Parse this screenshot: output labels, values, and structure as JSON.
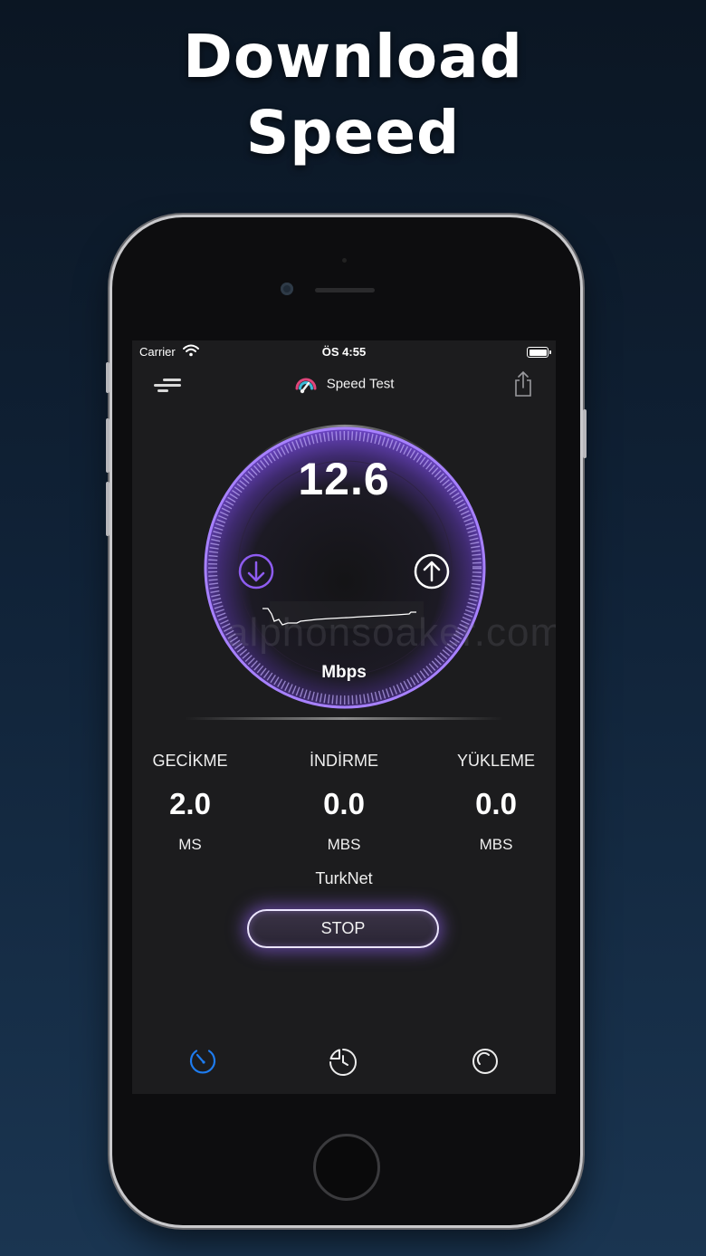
{
  "headline": {
    "line1": "Download",
    "line2": "Speed"
  },
  "status_bar": {
    "carrier": "Carrier",
    "time": "ÖS 4:55"
  },
  "nav": {
    "title": "Speed Test"
  },
  "gauge": {
    "speed": "12.6",
    "unit": "Mbps",
    "watermark": "alphonsoaker.com",
    "progress": 0.45
  },
  "stats": [
    {
      "label": "GECİKME",
      "value": "2.0",
      "unit": "MS"
    },
    {
      "label": "İNDİRME",
      "value": "0.0",
      "unit": "MBS"
    },
    {
      "label": "YÜKLEME",
      "value": "0.0",
      "unit": "MBS"
    }
  ],
  "provider": "TurkNet",
  "stop_button": {
    "label": "STOP"
  },
  "tabs": [
    {
      "name": "speedometer-icon",
      "active": true
    },
    {
      "name": "history-icon",
      "active": false
    },
    {
      "name": "circle-icon",
      "active": false
    }
  ],
  "colors": {
    "accent": "#8e5cf0",
    "tab_active": "#1e7cf0",
    "screen_bg": "#1c1c1e"
  }
}
